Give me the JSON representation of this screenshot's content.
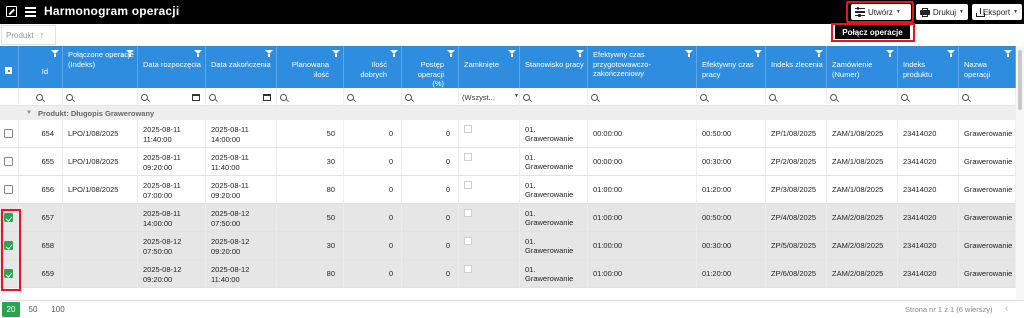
{
  "app": {
    "title": "Harmonogram operacji"
  },
  "toolbar": {
    "create_label": "Utwórz",
    "print_label": "Drukuj",
    "export_label": "Eksport",
    "popup_merge_label": "Połącz operacje"
  },
  "groupby": {
    "chip_label": "Produkt"
  },
  "columns": [
    {
      "label": "Id"
    },
    {
      "label": "Połączone operacje (Indeks)"
    },
    {
      "label": "Data rozpoczęcia"
    },
    {
      "label": "Data zakończenia"
    },
    {
      "label": "Planowana ilość"
    },
    {
      "label": "Ilość dobrych"
    },
    {
      "label": "Postęp operacji (%)"
    },
    {
      "label": "Zamknięte"
    },
    {
      "label": "Stanowisko pracy"
    },
    {
      "label": "Efektywny czas przygotowawczo-zakończeniowy"
    },
    {
      "label": "Efektywny czas pracy"
    },
    {
      "label": "Indeks zlecenia"
    },
    {
      "label": "Zamówienie (Numer)"
    },
    {
      "label": "Indeks produktu"
    },
    {
      "label": "Nazwa operacji"
    }
  ],
  "filters": {
    "closed_select": "(Wszyst..."
  },
  "group": {
    "label": "Produkt: Długopis Grawerowany"
  },
  "rows": [
    {
      "selected": false,
      "id": "654",
      "linked": "LPO/1/08/2025",
      "start": "2025-08-11 11:40:00",
      "end": "2025-08-11 14:00:00",
      "planned": "50",
      "good": "0",
      "progress": "0",
      "workstation": "01. Grawerowanie",
      "setup": "00:00:00",
      "worktime": "00:50:00",
      "order_index": "ZP/1/08/2025",
      "order_no": "ZAM/1/08/2025",
      "product_index": "23414020",
      "op_name": "Grawerowanie"
    },
    {
      "selected": false,
      "id": "655",
      "linked": "LPO/1/08/2025",
      "start": "2025-08-11 09:20:00",
      "end": "2025-08-11 11:40:00",
      "planned": "30",
      "good": "0",
      "progress": "0",
      "workstation": "01. Grawerowanie",
      "setup": "00:00:00",
      "worktime": "00:30:00",
      "order_index": "ZP/2/08/2025",
      "order_no": "ZAM/1/08/2025",
      "product_index": "23414020",
      "op_name": "Grawerowanie"
    },
    {
      "selected": false,
      "id": "656",
      "linked": "LPO/1/08/2025",
      "start": "2025-08-11 07:00:00",
      "end": "2025-08-11 09:20:00",
      "planned": "80",
      "good": "0",
      "progress": "0",
      "workstation": "01. Grawerowanie",
      "setup": "01:00:00",
      "worktime": "01:20:00",
      "order_index": "ZP/3/08/2025",
      "order_no": "ZAM/1/08/2025",
      "product_index": "23414020",
      "op_name": "Grawerowanie"
    },
    {
      "selected": true,
      "id": "657",
      "linked": "",
      "start": "2025-08-11 14:00:00",
      "end": "2025-08-12 07:50:00",
      "planned": "50",
      "good": "0",
      "progress": "0",
      "workstation": "01. Grawerowanie",
      "setup": "01:00:00",
      "worktime": "00:50:00",
      "order_index": "ZP/4/08/2025",
      "order_no": "ZAM/2/08/2025",
      "product_index": "23414020",
      "op_name": "Grawerowanie"
    },
    {
      "selected": true,
      "id": "658",
      "linked": "",
      "start": "2025-08-12 07:50:00",
      "end": "2025-08-12 09:20:00",
      "planned": "30",
      "good": "0",
      "progress": "0",
      "workstation": "01. Grawerowanie",
      "setup": "01:00:00",
      "worktime": "00:30:00",
      "order_index": "ZP/5/08/2025",
      "order_no": "ZAM/2/08/2025",
      "product_index": "23414020",
      "op_name": "Grawerowanie"
    },
    {
      "selected": true,
      "id": "659",
      "linked": "",
      "start": "2025-08-12 09:20:00",
      "end": "2025-08-12 11:40:00",
      "planned": "80",
      "good": "0",
      "progress": "0",
      "workstation": "01. Grawerowanie",
      "setup": "01:00:00",
      "worktime": "01:20:00",
      "order_index": "ZP/6/08/2025",
      "order_no": "ZAM/2/08/2025",
      "product_index": "23414020",
      "op_name": "Grawerowanie"
    }
  ],
  "footer": {
    "page_sizes": [
      "20",
      "50",
      "100"
    ],
    "active_page_size": "20",
    "page_info": "Strona nr 1 z 1 (6 wierszy)"
  },
  "colors": {
    "header": "#2f8de0",
    "accent_green": "#2aa44f",
    "highlight_red": "#e8141c"
  }
}
